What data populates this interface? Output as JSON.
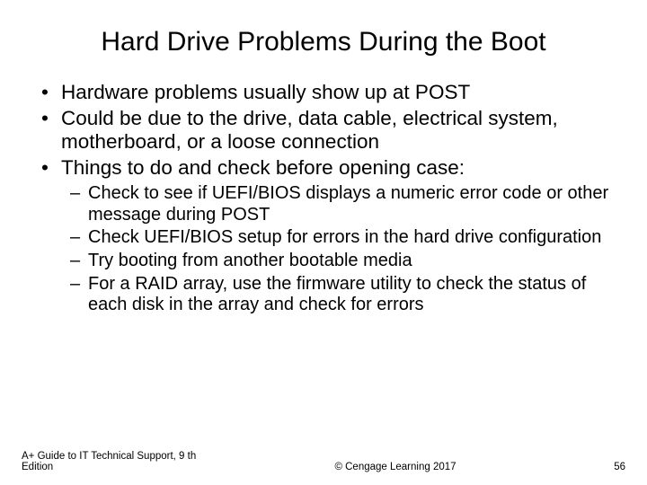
{
  "title": "Hard Drive Problems During the Boot",
  "bullets": [
    {
      "text": "Hardware problems usually show up at POST"
    },
    {
      "text": "Could be due to the drive, data cable, electrical system, motherboard, or a loose connection"
    },
    {
      "text": "Things to do and check before opening case:",
      "sub": [
        "Check to see if UEFI/BIOS displays a numeric error code or other message during POST",
        "Check UEFI/BIOS setup for errors in the hard drive configuration",
        "Try booting from another bootable media",
        "For a RAID array, use the firmware utility to check the status of each disk in the array and check for errors"
      ]
    }
  ],
  "footer": {
    "left": "A+ Guide to IT Technical Support, 9 th Edition",
    "center": "© Cengage Learning  2017",
    "right": "56"
  }
}
